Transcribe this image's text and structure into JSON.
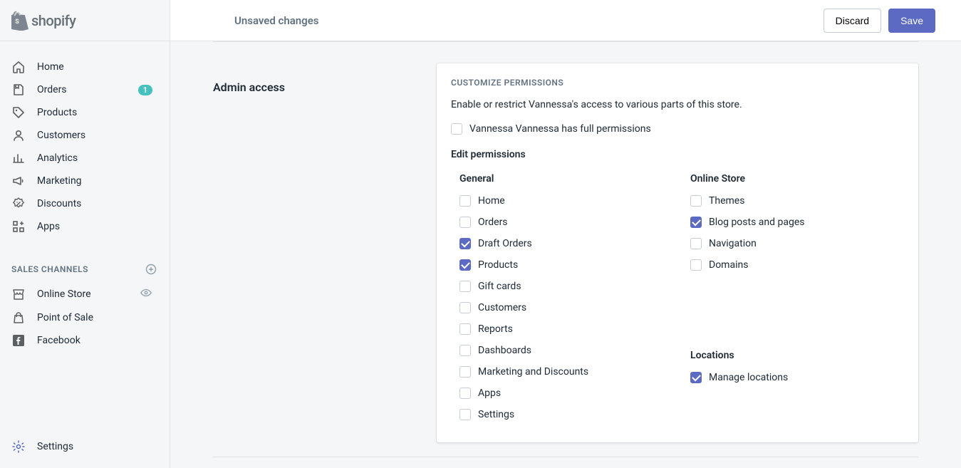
{
  "brand": "shopify",
  "topbar": {
    "title": "Unsaved changes",
    "discard": "Discard",
    "save": "Save"
  },
  "sidebar": {
    "nav": [
      {
        "label": "Home",
        "icon": "home"
      },
      {
        "label": "Orders",
        "icon": "orders",
        "badge": "1"
      },
      {
        "label": "Products",
        "icon": "products"
      },
      {
        "label": "Customers",
        "icon": "customers"
      },
      {
        "label": "Analytics",
        "icon": "analytics"
      },
      {
        "label": "Marketing",
        "icon": "marketing"
      },
      {
        "label": "Discounts",
        "icon": "discounts"
      },
      {
        "label": "Apps",
        "icon": "apps"
      }
    ],
    "sales_channels_title": "SALES CHANNELS",
    "channels": [
      {
        "label": "Online Store",
        "icon": "online-store",
        "action": "eye"
      },
      {
        "label": "Point of Sale",
        "icon": "pos"
      },
      {
        "label": "Facebook",
        "icon": "facebook"
      }
    ],
    "settings": "Settings"
  },
  "panel": {
    "title": "Admin access",
    "subtitle": "CUSTOMIZE PERMISSIONS",
    "description": "Enable or restrict Vannessa's access to various parts of this store.",
    "full_permissions_label": "Vannessa Vannessa has full permissions",
    "edit_heading": "Edit permissions",
    "groups": {
      "general": {
        "title": "General",
        "items": [
          {
            "label": "Home",
            "checked": false
          },
          {
            "label": "Orders",
            "checked": false
          },
          {
            "label": "Draft Orders",
            "checked": true
          },
          {
            "label": "Products",
            "checked": true
          },
          {
            "label": "Gift cards",
            "checked": false
          },
          {
            "label": "Customers",
            "checked": false
          },
          {
            "label": "Reports",
            "checked": false
          },
          {
            "label": "Dashboards",
            "checked": false
          },
          {
            "label": "Marketing and Discounts",
            "checked": false
          },
          {
            "label": "Apps",
            "checked": false
          },
          {
            "label": "Settings",
            "checked": false
          }
        ]
      },
      "online_store": {
        "title": "Online Store",
        "items": [
          {
            "label": "Themes",
            "checked": false
          },
          {
            "label": "Blog posts and pages",
            "checked": true
          },
          {
            "label": "Navigation",
            "checked": false
          },
          {
            "label": "Domains",
            "checked": false
          }
        ]
      },
      "locations": {
        "title": "Locations",
        "items": [
          {
            "label": "Manage locations",
            "checked": true
          }
        ]
      }
    }
  }
}
